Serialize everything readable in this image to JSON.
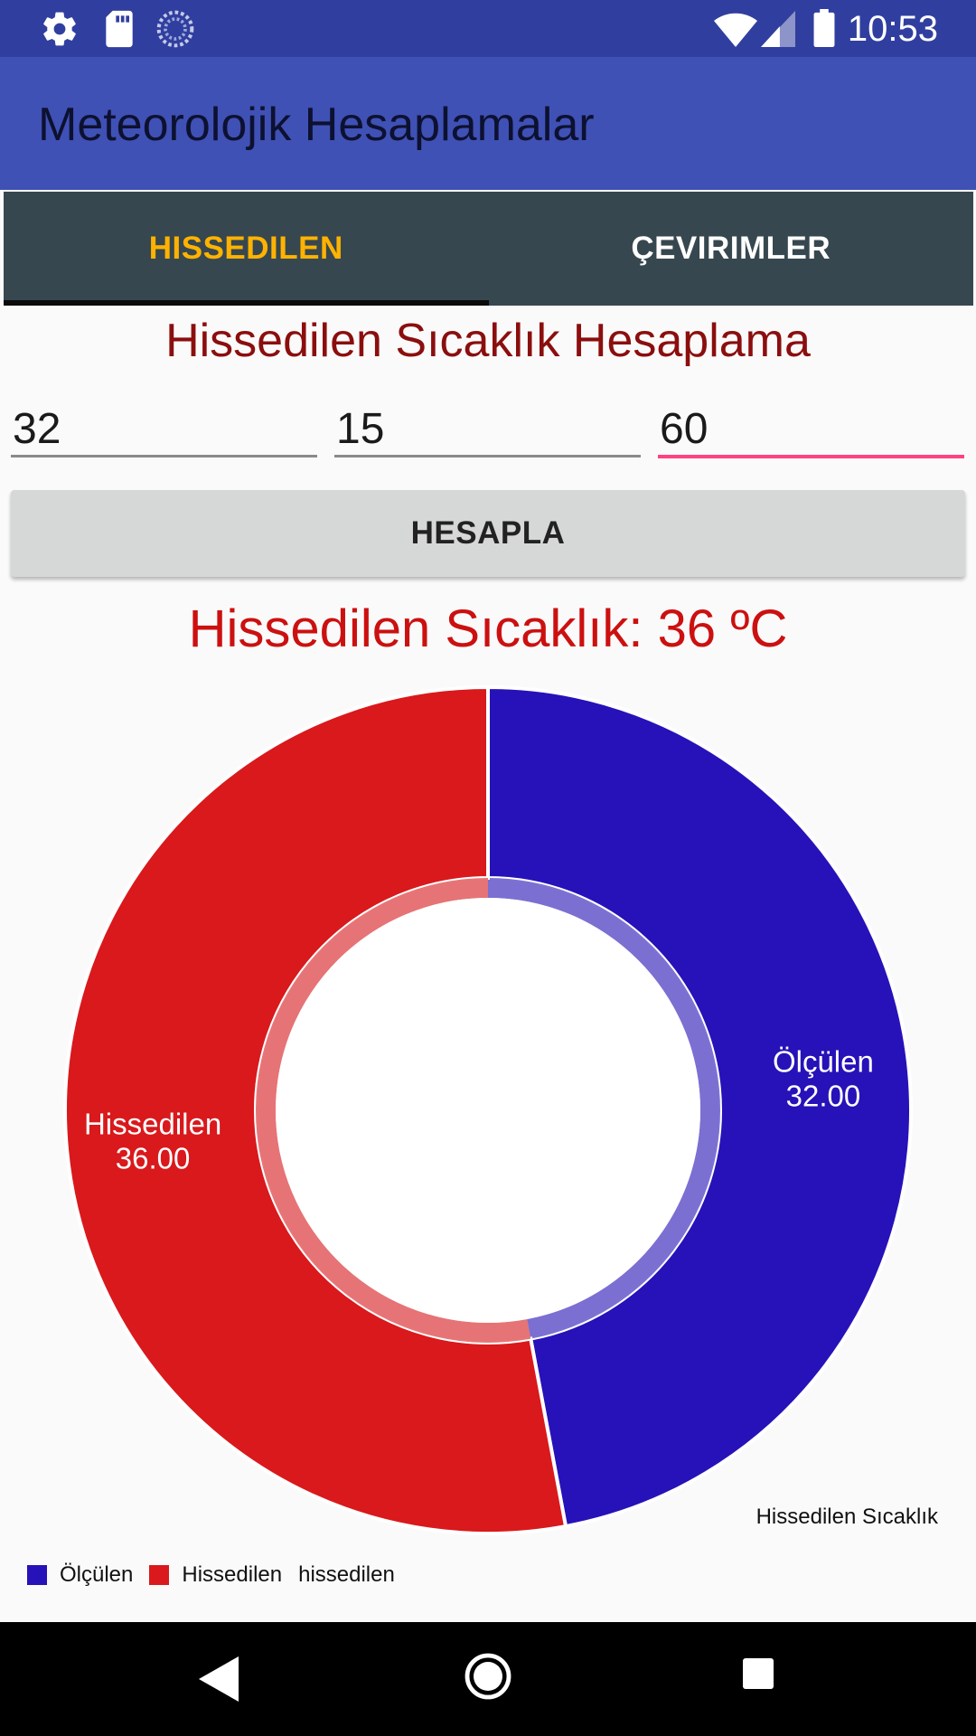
{
  "status_bar": {
    "time": "10:53",
    "icons": [
      "gear-icon",
      "sd-card-icon",
      "sync-icon",
      "wifi-icon",
      "signal-icon",
      "battery-icon"
    ]
  },
  "app_bar": {
    "title": "Meteorolojik Hesaplamalar",
    "color": "#3f51b5"
  },
  "tabs": [
    {
      "label": "HISSEDILEN",
      "active": true
    },
    {
      "label": "ÇEVIRIMLER",
      "active": false
    }
  ],
  "form": {
    "heading": "Hissedilen Sıcaklık Hesaplama",
    "inputs": [
      {
        "value": "32"
      },
      {
        "value": "15"
      },
      {
        "value": "60"
      }
    ],
    "button_label": "HESAPLA"
  },
  "result": {
    "text": "Hissedilen Sıcaklık: 36 ºC"
  },
  "chart_data": {
    "type": "pie",
    "categories": [
      "Ölçülen",
      "Hissedilen"
    ],
    "values": [
      32.0,
      36.0
    ],
    "value_labels": [
      "32.00",
      "36.00"
    ],
    "colors": [
      "#2612b8",
      "#d9191c"
    ],
    "description": "Hissedilen Sıcaklık",
    "legend": {
      "placement": "bottom-left",
      "entries": [
        "Ölçülen",
        "Hissedilen"
      ],
      "dataset_label": "hissedilen"
    },
    "hole": true
  },
  "nav_bar": {
    "icons": [
      "back-icon",
      "home-icon",
      "recents-icon"
    ]
  }
}
